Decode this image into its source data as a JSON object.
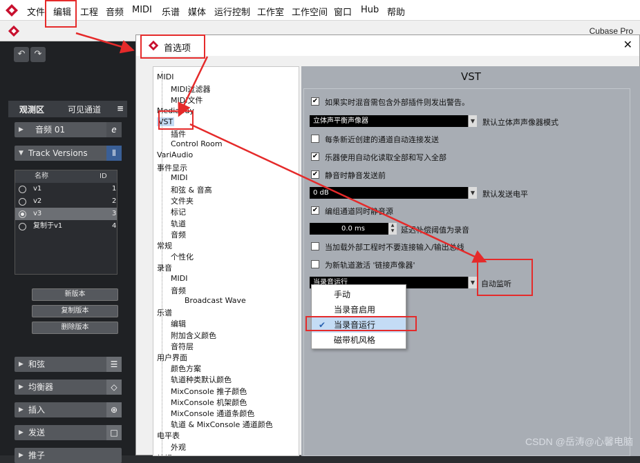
{
  "menubar": {
    "items": [
      "文件",
      "编辑",
      "工程",
      "音频",
      "MIDI",
      "乐谱",
      "媒体",
      "运行控制",
      "工作室",
      "工作空间",
      "窗口",
      "Hub",
      "帮助"
    ]
  },
  "app": {
    "title": "Cubase Pro"
  },
  "left_panel": {
    "tabs": [
      "观测区",
      "可见通道"
    ],
    "track_name": "音频 01",
    "track_versions_label": "Track Versions",
    "table_headers": {
      "name": "名称",
      "id": "ID"
    },
    "versions": [
      {
        "name": "v1",
        "id": "1",
        "active": false
      },
      {
        "name": "v2",
        "id": "2",
        "active": false
      },
      {
        "name": "v3",
        "id": "3",
        "active": true
      },
      {
        "name": "复制于v1",
        "id": "4",
        "active": false
      }
    ],
    "buttons": [
      "新版本",
      "复制版本",
      "删除版本"
    ],
    "sections": [
      "和弦",
      "均衡器",
      "插入",
      "发送",
      "推子"
    ]
  },
  "dialog": {
    "title": "首选项",
    "close": "✕",
    "tree": [
      {
        "label": "MIDI",
        "level": 0
      },
      {
        "label": "MIDI过滤器",
        "level": 1
      },
      {
        "label": "MIDI文件",
        "level": 1
      },
      {
        "label": "MediaBay",
        "level": 0
      },
      {
        "label": "VST",
        "level": 0,
        "selected": true
      },
      {
        "label": "插件",
        "level": 1
      },
      {
        "label": "Control Room",
        "level": 1
      },
      {
        "label": "VariAudio",
        "level": 0
      },
      {
        "label": "事件显示",
        "level": 0
      },
      {
        "label": "MIDI",
        "level": 1
      },
      {
        "label": "和弦 & 音高",
        "level": 1
      },
      {
        "label": "文件夹",
        "level": 1
      },
      {
        "label": "标记",
        "level": 1
      },
      {
        "label": "轨道",
        "level": 1
      },
      {
        "label": "音频",
        "level": 1
      },
      {
        "label": "常规",
        "level": 0
      },
      {
        "label": "个性化",
        "level": 1
      },
      {
        "label": "录音",
        "level": 0
      },
      {
        "label": "MIDI",
        "level": 1
      },
      {
        "label": "音频",
        "level": 1
      },
      {
        "label": "Broadcast Wave",
        "level": 2
      },
      {
        "label": "乐谱",
        "level": 0
      },
      {
        "label": "编辑",
        "level": 1
      },
      {
        "label": "附加含义颜色",
        "level": 1
      },
      {
        "label": "音符层",
        "level": 1
      },
      {
        "label": "用户界面",
        "level": 0
      },
      {
        "label": "颜色方案",
        "level": 1
      },
      {
        "label": "轨道种类默认颜色",
        "level": 1
      },
      {
        "label": "MixConsole 推子颜色",
        "level": 1
      },
      {
        "label": "MixConsole 机架颜色",
        "level": 1
      },
      {
        "label": "MixConsole 通道条颜色",
        "level": 1
      },
      {
        "label": "轨道 & MixConsole 通道颜色",
        "level": 1
      },
      {
        "label": "电平表",
        "level": 0
      },
      {
        "label": "外观",
        "level": 1
      },
      {
        "label": "编辑",
        "level": 0
      }
    ],
    "panel_heading": "VST",
    "settings": {
      "warn_external": {
        "label": "如果实时混音需包含外部插件则发出警告。",
        "checked": true
      },
      "pan_mode": {
        "value": "立体声平衡声像器",
        "label": "默认立体声声像器模式"
      },
      "auto_connect_sends": {
        "label": "每条新近创建的通道自动连接发送",
        "checked": false
      },
      "instrument_automation": {
        "label": "乐器使用自动化读取全部和写入全部",
        "checked": true
      },
      "mute_pre_send": {
        "label": "静音时静音发送前",
        "checked": true
      },
      "send_level": {
        "value": "0 dB",
        "label": "默认发送电平"
      },
      "group_mute": {
        "label": "编组通道同时静音源",
        "checked": true
      },
      "delay_comp": {
        "value": "0.0 ms",
        "label": "延迟补偿阈值为录音"
      },
      "no_connect_external": {
        "label": "当加载外部工程时不要连接输入/输出总线",
        "checked": false
      },
      "link_panner": {
        "label": "为新轨道激活 '链接声像器'",
        "checked": false
      },
      "auto_monitor": {
        "value": "当录音运行",
        "label": "自动监听"
      }
    },
    "popup_options": [
      "手动",
      "当录音启用",
      "当录音运行",
      "磁带机风格"
    ],
    "popup_selected": "当录音运行"
  },
  "watermark": "CSDN @岳涛@心馨电脑",
  "colors": {
    "annotation": "#e52a2a",
    "selection": "#c4dcf5"
  }
}
